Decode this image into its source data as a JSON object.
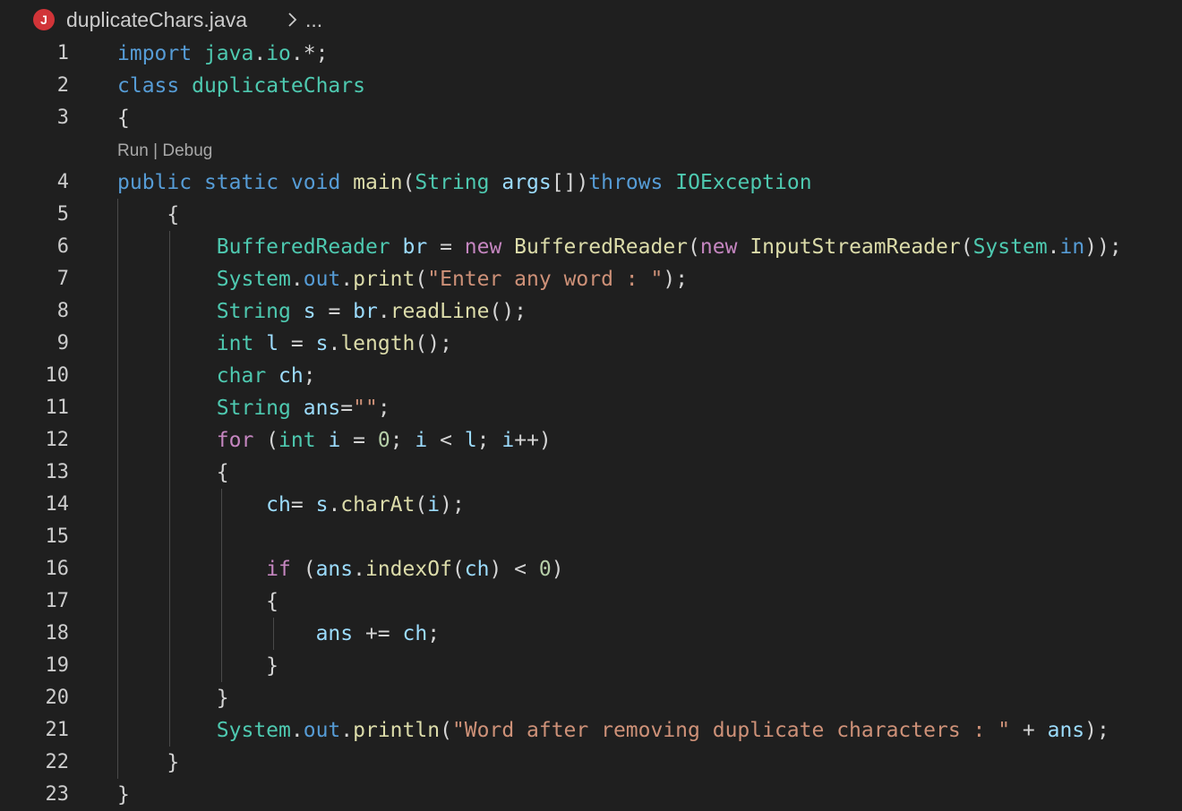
{
  "breadcrumb": {
    "file_icon_letter": "J",
    "file_name": "duplicateChars.java",
    "separator_icon": "chevron-right-icon",
    "more": "..."
  },
  "codelens": {
    "run": "Run",
    "divider": " | ",
    "debug": "Debug"
  },
  "colors": {
    "background": "#1f1f1f",
    "keyword": "#569cd6",
    "control": "#c586c0",
    "type": "#4ec9b0",
    "variable": "#9cdcfe",
    "function": "#dcdcaa",
    "string": "#ce9178",
    "number": "#b5cea8",
    "punctuation": "#d4d4d4",
    "java_icon": "#d13438"
  },
  "lines": [
    {
      "n": "1",
      "tokens": [
        [
          "import",
          "kw"
        ],
        [
          " ",
          "pn"
        ],
        [
          "java",
          "ty"
        ],
        [
          ".",
          "pn"
        ],
        [
          "io",
          "ty"
        ],
        [
          ".*;",
          "pn"
        ]
      ]
    },
    {
      "n": "2",
      "tokens": [
        [
          "class",
          "kw"
        ],
        [
          " ",
          "pn"
        ],
        [
          "duplicateChars",
          "ty"
        ]
      ]
    },
    {
      "n": "3",
      "tokens": [
        [
          "{",
          "pn"
        ]
      ]
    },
    {
      "n": "4",
      "tokens": [
        [
          "public",
          "kw"
        ],
        [
          " ",
          "pn"
        ],
        [
          "static",
          "kw"
        ],
        [
          " ",
          "pn"
        ],
        [
          "void",
          "kw"
        ],
        [
          " ",
          "pn"
        ],
        [
          "main",
          "fn"
        ],
        [
          "(",
          "pn"
        ],
        [
          "String",
          "ty"
        ],
        [
          " ",
          "pn"
        ],
        [
          "args",
          "var"
        ],
        [
          "[])",
          "pn"
        ],
        [
          "throws",
          "kw"
        ],
        [
          " ",
          "pn"
        ],
        [
          "IOException",
          "ty"
        ]
      ]
    },
    {
      "n": "5",
      "tokens": [
        [
          "    {",
          "pn"
        ]
      ]
    },
    {
      "n": "6",
      "tokens": [
        [
          "        ",
          "pn"
        ],
        [
          "BufferedReader",
          "ty"
        ],
        [
          " ",
          "pn"
        ],
        [
          "br",
          "var"
        ],
        [
          " = ",
          "pn"
        ],
        [
          "new",
          "ctl"
        ],
        [
          " ",
          "pn"
        ],
        [
          "BufferedReader",
          "fn"
        ],
        [
          "(",
          "pn"
        ],
        [
          "new",
          "ctl"
        ],
        [
          " ",
          "pn"
        ],
        [
          "InputStreamReader",
          "fn"
        ],
        [
          "(",
          "pn"
        ],
        [
          "System",
          "ty"
        ],
        [
          ".",
          "pn"
        ],
        [
          "in",
          "kw"
        ],
        [
          "));",
          "pn"
        ]
      ]
    },
    {
      "n": "7",
      "tokens": [
        [
          "        ",
          "pn"
        ],
        [
          "System",
          "ty"
        ],
        [
          ".",
          "pn"
        ],
        [
          "out",
          "kw"
        ],
        [
          ".",
          "pn"
        ],
        [
          "print",
          "fn"
        ],
        [
          "(",
          "pn"
        ],
        [
          "\"Enter any word : \"",
          "str"
        ],
        [
          ");",
          "pn"
        ]
      ]
    },
    {
      "n": "8",
      "tokens": [
        [
          "        ",
          "pn"
        ],
        [
          "String",
          "ty"
        ],
        [
          " ",
          "pn"
        ],
        [
          "s",
          "var"
        ],
        [
          " = ",
          "pn"
        ],
        [
          "br",
          "var"
        ],
        [
          ".",
          "pn"
        ],
        [
          "readLine",
          "fn"
        ],
        [
          "();",
          "pn"
        ]
      ]
    },
    {
      "n": "9",
      "tokens": [
        [
          "        ",
          "pn"
        ],
        [
          "int",
          "ty"
        ],
        [
          " ",
          "pn"
        ],
        [
          "l",
          "var"
        ],
        [
          " = ",
          "pn"
        ],
        [
          "s",
          "var"
        ],
        [
          ".",
          "pn"
        ],
        [
          "length",
          "fn"
        ],
        [
          "();",
          "pn"
        ]
      ]
    },
    {
      "n": "10",
      "tokens": [
        [
          "        ",
          "pn"
        ],
        [
          "char",
          "ty"
        ],
        [
          " ",
          "pn"
        ],
        [
          "ch",
          "var"
        ],
        [
          ";",
          "pn"
        ]
      ]
    },
    {
      "n": "11",
      "tokens": [
        [
          "        ",
          "pn"
        ],
        [
          "String",
          "ty"
        ],
        [
          " ",
          "pn"
        ],
        [
          "ans",
          "var"
        ],
        [
          "=",
          "pn"
        ],
        [
          "\"\"",
          "str"
        ],
        [
          ";",
          "pn"
        ]
      ]
    },
    {
      "n": "12",
      "tokens": [
        [
          "        ",
          "pn"
        ],
        [
          "for",
          "ctl"
        ],
        [
          " (",
          "pn"
        ],
        [
          "int",
          "ty"
        ],
        [
          " ",
          "pn"
        ],
        [
          "i",
          "var"
        ],
        [
          " = ",
          "pn"
        ],
        [
          "0",
          "num"
        ],
        [
          "; ",
          "pn"
        ],
        [
          "i",
          "var"
        ],
        [
          " < ",
          "pn"
        ],
        [
          "l",
          "var"
        ],
        [
          "; ",
          "pn"
        ],
        [
          "i",
          "var"
        ],
        [
          "++)",
          "pn"
        ]
      ]
    },
    {
      "n": "13",
      "tokens": [
        [
          "        {",
          "pn"
        ]
      ]
    },
    {
      "n": "14",
      "tokens": [
        [
          "            ",
          "pn"
        ],
        [
          "ch",
          "var"
        ],
        [
          "= ",
          "pn"
        ],
        [
          "s",
          "var"
        ],
        [
          ".",
          "pn"
        ],
        [
          "charAt",
          "fn"
        ],
        [
          "(",
          "pn"
        ],
        [
          "i",
          "var"
        ],
        [
          ");",
          "pn"
        ]
      ]
    },
    {
      "n": "15",
      "tokens": []
    },
    {
      "n": "16",
      "tokens": [
        [
          "            ",
          "pn"
        ],
        [
          "if",
          "ctl"
        ],
        [
          " (",
          "pn"
        ],
        [
          "ans",
          "var"
        ],
        [
          ".",
          "pn"
        ],
        [
          "indexOf",
          "fn"
        ],
        [
          "(",
          "pn"
        ],
        [
          "ch",
          "var"
        ],
        [
          ") < ",
          "pn"
        ],
        [
          "0",
          "num"
        ],
        [
          ")",
          "pn"
        ]
      ]
    },
    {
      "n": "17",
      "tokens": [
        [
          "            {",
          "pn"
        ]
      ]
    },
    {
      "n": "18",
      "tokens": [
        [
          "                ",
          "pn"
        ],
        [
          "ans",
          "var"
        ],
        [
          " += ",
          "pn"
        ],
        [
          "ch",
          "var"
        ],
        [
          ";",
          "pn"
        ]
      ]
    },
    {
      "n": "19",
      "tokens": [
        [
          "            }",
          "pn"
        ]
      ]
    },
    {
      "n": "20",
      "tokens": [
        [
          "        }",
          "pn"
        ]
      ]
    },
    {
      "n": "21",
      "tokens": [
        [
          "        ",
          "pn"
        ],
        [
          "System",
          "ty"
        ],
        [
          ".",
          "pn"
        ],
        [
          "out",
          "kw"
        ],
        [
          ".",
          "pn"
        ],
        [
          "println",
          "fn"
        ],
        [
          "(",
          "pn"
        ],
        [
          "\"Word after removing duplicate characters : \"",
          "str"
        ],
        [
          " + ",
          "pn"
        ],
        [
          "ans",
          "var"
        ],
        [
          ");",
          "pn"
        ]
      ]
    },
    {
      "n": "22",
      "tokens": [
        [
          "    }",
          "pn"
        ]
      ]
    },
    {
      "n": "23",
      "tokens": [
        [
          "}",
          "pn"
        ]
      ]
    }
  ]
}
